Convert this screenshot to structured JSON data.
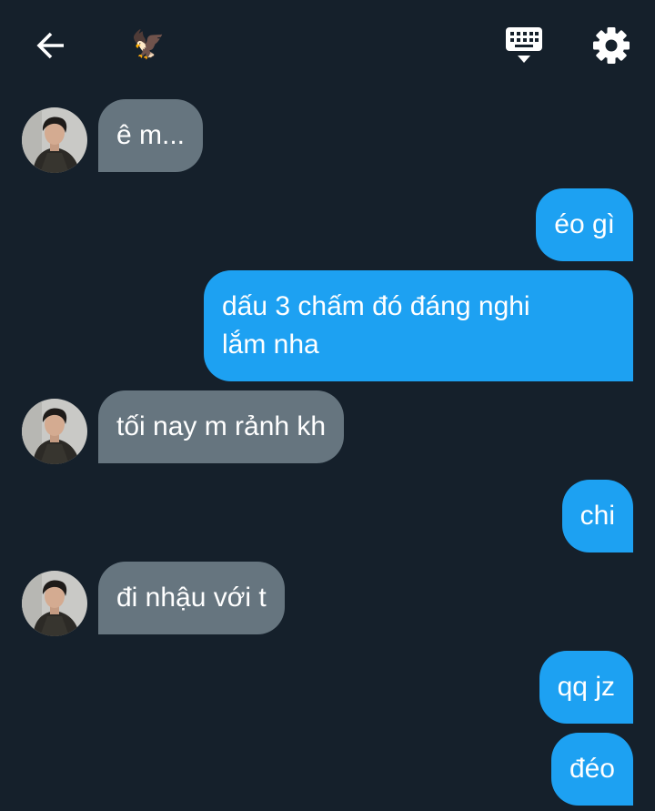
{
  "header": {
    "back_icon": "arrow-left-icon",
    "title_emoji": "🦅",
    "keyboard_icon": "keyboard-icon",
    "settings_icon": "gear-icon"
  },
  "colors": {
    "background": "#15202b",
    "incoming_bubble": "#66757f",
    "outgoing_bubble": "#1da1f2",
    "text": "#ffffff"
  },
  "messages": [
    {
      "direction": "incoming",
      "text": "ê m..."
    },
    {
      "direction": "outgoing",
      "text": "éo gì"
    },
    {
      "direction": "outgoing",
      "text": "dấu 3 chấm đó đáng nghi\nlắm nha"
    },
    {
      "direction": "incoming",
      "text": "tối nay m rảnh kh"
    },
    {
      "direction": "outgoing",
      "text": "chi"
    },
    {
      "direction": "incoming",
      "text": "đi nhậu với t"
    },
    {
      "direction": "outgoing",
      "text": "qq jz"
    },
    {
      "direction": "outgoing",
      "text": "đéo"
    }
  ]
}
